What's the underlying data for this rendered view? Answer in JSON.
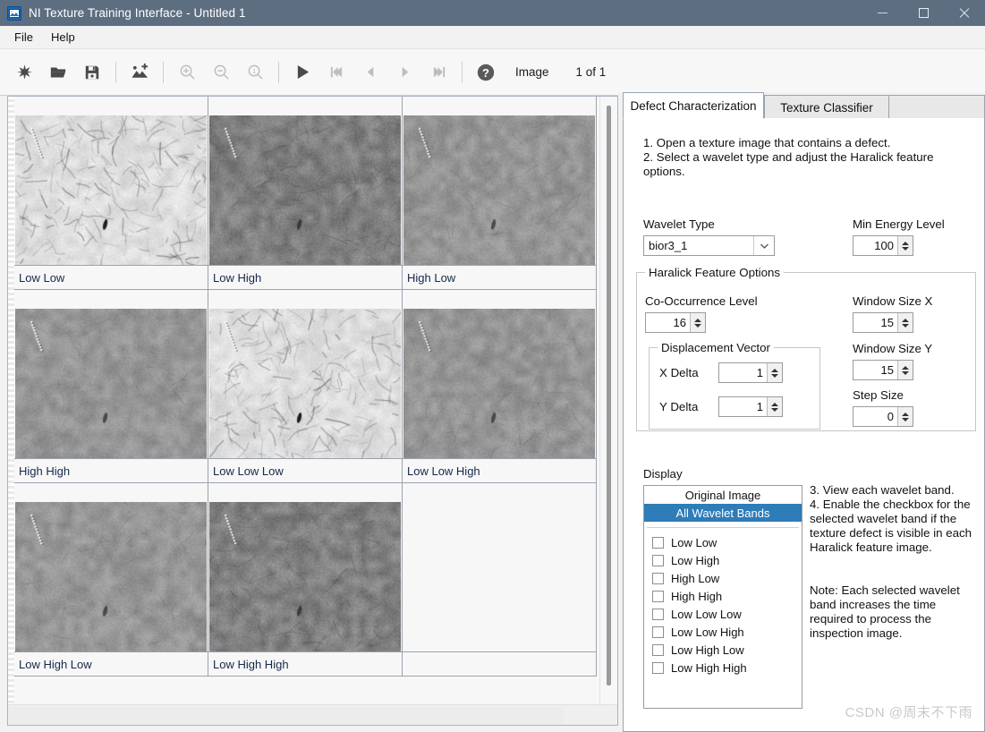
{
  "window": {
    "title": "NI Texture Training Interface - Untitled 1",
    "icon": "image-app-icon",
    "minimize": "minimize-icon",
    "maximize": "maximize-icon",
    "close": "close-icon",
    "titlebar_color": "#5e6e81"
  },
  "menu": {
    "items": [
      {
        "label": "File"
      },
      {
        "label": "Help"
      }
    ]
  },
  "toolbar": {
    "buttons": [
      {
        "name": "new-button",
        "icon": "asterisk-icon",
        "enabled": true
      },
      {
        "name": "open-button",
        "icon": "folder-open-icon",
        "enabled": true
      },
      {
        "name": "save-button",
        "icon": "floppy-save-icon",
        "enabled": true
      },
      {
        "name": "add-image-button",
        "icon": "add-image-icon",
        "enabled": true
      },
      {
        "name": "zoom-in-button",
        "icon": "zoom-in-icon",
        "enabled": false
      },
      {
        "name": "zoom-out-button",
        "icon": "zoom-out-icon",
        "enabled": false
      },
      {
        "name": "zoom-actual-button",
        "icon": "zoom-one-to-one-icon",
        "enabled": false
      },
      {
        "name": "play-button",
        "icon": "play-icon",
        "enabled": true
      },
      {
        "name": "first-image-button",
        "icon": "skip-first-icon",
        "enabled": false
      },
      {
        "name": "previous-image-button",
        "icon": "arrow-left-icon",
        "enabled": false
      },
      {
        "name": "next-image-button",
        "icon": "arrow-right-icon",
        "enabled": false
      },
      {
        "name": "last-image-button",
        "icon": "skip-last-icon",
        "enabled": false
      },
      {
        "name": "help-button",
        "icon": "question-help-icon",
        "enabled": true
      }
    ],
    "image_label": "Image",
    "image_counter": "1 of 1"
  },
  "image_grid": {
    "cells": [
      {
        "label": "Low Low",
        "tone": "light",
        "seed": 11
      },
      {
        "label": "Low High",
        "tone": "dark",
        "seed": 22
      },
      {
        "label": "High Low",
        "tone": "mid",
        "seed": 33
      },
      {
        "label": "High High",
        "tone": "mid",
        "seed": 44
      },
      {
        "label": "Low Low Low",
        "tone": "light",
        "seed": 55
      },
      {
        "label": "Low Low High",
        "tone": "mid",
        "seed": 66
      },
      {
        "label": "Low High Low",
        "tone": "mid",
        "seed": 77
      },
      {
        "label": "Low High High",
        "tone": "dark",
        "seed": 88
      },
      {
        "label": "",
        "tone": "empty",
        "seed": 0
      }
    ]
  },
  "right_panel": {
    "tabs": [
      {
        "label": "Defect Characterization",
        "active": true
      },
      {
        "label": "Texture Classifier",
        "active": false
      }
    ],
    "instructions_top": "1. Open a texture image that contains a defect.\n2. Select a wavelet type and adjust the Haralick feature options.",
    "wavelet_type": {
      "label": "Wavelet Type",
      "value": "bior3_1"
    },
    "min_energy_level": {
      "label": "Min Energy Level",
      "value": "100"
    },
    "haralick": {
      "title": "Haralick Feature Options",
      "co_occurrence_level": {
        "label": "Co-Occurrence Level",
        "value": "16"
      },
      "displacement_vector": {
        "title": "Displacement Vector",
        "x_delta": {
          "label": "X Delta",
          "value": "1"
        },
        "y_delta": {
          "label": "Y Delta",
          "value": "1"
        }
      },
      "window_size_x": {
        "label": "Window Size X",
        "value": "15"
      },
      "window_size_y": {
        "label": "Window Size Y",
        "value": "15"
      },
      "step_size": {
        "label": "Step Size",
        "value": "0"
      }
    },
    "display": {
      "title": "Display",
      "modes": [
        {
          "label": "Original Image",
          "selected": false
        },
        {
          "label": "All Wavelet Bands",
          "selected": true
        }
      ],
      "bands": [
        {
          "label": "Low Low",
          "checked": false
        },
        {
          "label": "Low High",
          "checked": false
        },
        {
          "label": "High Low",
          "checked": false
        },
        {
          "label": "High High",
          "checked": false
        },
        {
          "label": "Low Low Low",
          "checked": false
        },
        {
          "label": "Low Low High",
          "checked": false
        },
        {
          "label": "Low High Low",
          "checked": false
        },
        {
          "label": "Low High High",
          "checked": false
        }
      ],
      "selection_color": "#2e7cb8"
    },
    "instructions_bottom": "3. View each wavelet band.\n4. Enable the checkbox for the selected wavelet band if the texture defect is visible in each Haralick feature image.",
    "note": "Note: Each selected wavelet band increases the time required to process the inspection image."
  },
  "watermark": {
    "text": "CSDN @周末不下雨"
  }
}
